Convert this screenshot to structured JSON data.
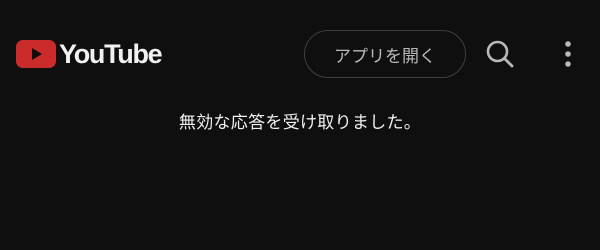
{
  "header": {
    "logo_text": "YouTube",
    "logo_icon": "youtube-play-icon",
    "open_app_label": "アプリを開く",
    "search_icon": "search-icon",
    "more_icon": "more-vert-icon"
  },
  "main": {
    "message": "無効な応答を受け取りました。"
  },
  "colors": {
    "background": "#0f0f0f",
    "logo_red": "#cc2b2b",
    "text": "#f1f1f1",
    "button_border": "#3f3f3f"
  }
}
